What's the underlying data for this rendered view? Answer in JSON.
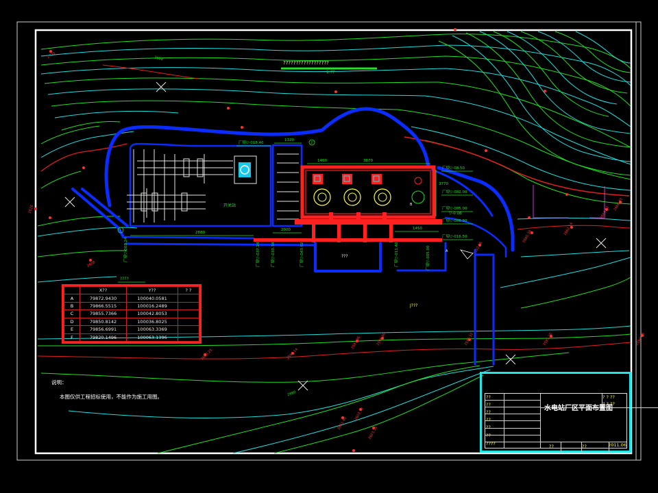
{
  "drawing": {
    "title_bar_text": "??????????????????",
    "title_bar_sub": "1:??",
    "levels": {
      "top_left_level": "厂坝▽-018.40",
      "right_level_1": "厂坝▽-08.50",
      "right_level_2": "厂坝▽-002.00",
      "right_level_3": "厂坝▽-005.00",
      "right_level_4": "厂坝▽-008.80",
      "right_level_5": "厂坝▽-016.50",
      "right_level_6": "厂坝▽-015.50",
      "v_level_1": "厂坝▽-003.24",
      "v_level_2": "厂坝▽-037.24",
      "v_level_3": "厂坝▽-033.34",
      "v_level_4": "厂坝▽-043.02",
      "v_level_5": "厂坝▽-011.40",
      "v_level_6": "厂坝▽-005.00",
      "ground_level": "▽-0.08"
    },
    "labels": {
      "switchyard": "开关站",
      "pit": "???",
      "point_j": "J???",
      "table_caption": "????",
      "contour_1": "2600",
      "contour_2": "2880",
      "small_a": "A",
      "small_b": "B",
      "axis_1": "1",
      "axis_2": "2"
    },
    "dimensions": {
      "dim_a": "2880",
      "dim_b": "3870",
      "dim_c": "1320",
      "dim_d": "1450",
      "dim_e": "3770",
      "dim_f": "2000",
      "dim_g": "1460"
    },
    "coord_table": {
      "headers": [
        "",
        "X??",
        "Y??",
        "? ?"
      ],
      "rows": [
        [
          "A",
          "79872.9430",
          "100040.0581",
          ""
        ],
        [
          "B",
          "79866.5515",
          "100016.2489",
          ""
        ],
        [
          "C",
          "79855.7366",
          "100042.8053",
          ""
        ],
        [
          "D",
          "79850.8142",
          "100036.8025",
          ""
        ],
        [
          "E",
          "79856.6991",
          "100063.3369",
          ""
        ],
        [
          "F",
          "79820.1496",
          "100063.1396",
          ""
        ]
      ]
    },
    "notes": {
      "heading": "说明：",
      "line_1": "本图仅供工程招标使用，不能作为施工用图。"
    },
    "title_block": {
      "title": "水电站厂区平面布置图",
      "date": "2011.06",
      "labels": [
        "??",
        "??",
        "??",
        "??",
        "??",
        "??",
        "????",
        "??",
        "??",
        "? ? ??",
        "? ? ??"
      ]
    },
    "colors": {
      "frame": "#ffffff",
      "wall": "#0a2cff",
      "powerhouse": "#ff2020",
      "contour_green": "#22e022",
      "contour_cyan": "#22dede",
      "contour_red": "#e02020",
      "title_block_border": "#22e5e5"
    }
  }
}
